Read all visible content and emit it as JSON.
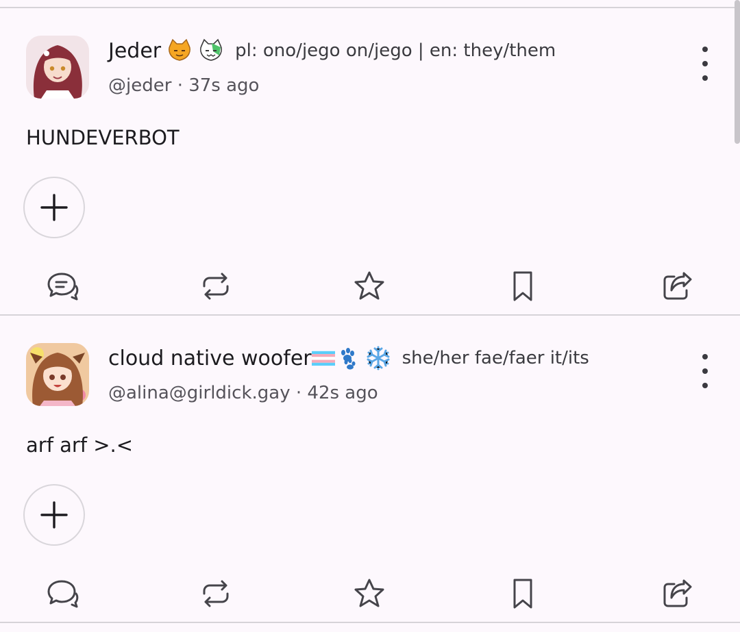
{
  "posts": [
    {
      "display_name": "Jeder",
      "name_emojis": [
        "cat-face-emoji",
        "cat-green-emoji"
      ],
      "pronouns": "pl: ono/jego on/jego | en: they/them",
      "handle": "@jeder",
      "separator": "·",
      "time": "37s ago",
      "content": "HUNDEVERBOT",
      "avatar_colors": {
        "bg": "#f2e4e8",
        "hair": "#8a2f3a",
        "face": "#f7dccd"
      }
    },
    {
      "display_name": "cloud native woofer",
      "name_emojis": [
        "transgender-flag-emoji",
        "paw-prints-emoji",
        "snowflake-emoji"
      ],
      "pronouns": "she/her fae/faer it/its",
      "handle": "@alina@girldick.gay",
      "separator": "·",
      "time": "42s ago",
      "content": "arf arf >.<",
      "avatar_colors": {
        "bg": "#f0c9a0",
        "hair": "#9c5a34",
        "face": "#fbe0cf"
      }
    }
  ],
  "actions": [
    "reply",
    "boost",
    "favourite",
    "bookmark",
    "share"
  ],
  "colors": {
    "background": "#fdf8fd",
    "divider": "#d6d3d8",
    "icon": "#45444a",
    "text": "#1c1b1f",
    "muted": "#55535a"
  }
}
